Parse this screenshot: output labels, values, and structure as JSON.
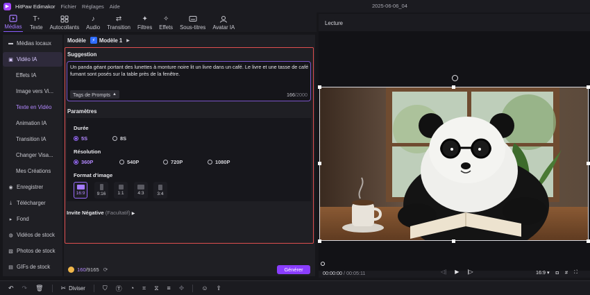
{
  "titlebar": {
    "app_name": "HitPaw Edimakor",
    "menu": [
      "Fichier",
      "Réglages",
      "Aide"
    ],
    "document_title": "2025-06-06_04"
  },
  "toolbar": {
    "items": [
      {
        "label": "Médias",
        "icon": "media-icon",
        "active": true
      },
      {
        "label": "Texte",
        "icon": "text-icon"
      },
      {
        "label": "Autocollants",
        "icon": "sticker-icon"
      },
      {
        "label": "Audio",
        "icon": "music-note-icon"
      },
      {
        "label": "Transition",
        "icon": "transition-arrows-icon"
      },
      {
        "label": "Filtres",
        "icon": "sparkle-filter-icon"
      },
      {
        "label": "Effets",
        "icon": "effects-icon"
      },
      {
        "label": "Sous-titres",
        "icon": "subtitle-icon"
      },
      {
        "label": "Avatar IA",
        "icon": "avatar-icon"
      }
    ]
  },
  "sidebar": {
    "items": [
      {
        "label": "Médias locaux",
        "icon": "folder-icon"
      },
      {
        "label": "Vidéo IA",
        "icon": "ai-video-icon",
        "state": "selected-parent"
      },
      {
        "label": "Effets IA",
        "sub": true
      },
      {
        "label": "Image vers Vi...",
        "sub": true
      },
      {
        "label": "Texte en Vidéo",
        "sub": true,
        "state": "selected-child"
      },
      {
        "label": "Animation IA",
        "sub": true
      },
      {
        "label": "Transition IA",
        "sub": true
      },
      {
        "label": "Changer Visa...",
        "sub": true
      },
      {
        "label": "Mes Créations",
        "sub": true
      },
      {
        "label": "Enregistrer",
        "icon": "record-icon"
      },
      {
        "label": "Télécharger",
        "icon": "download-icon"
      },
      {
        "label": "Fond",
        "icon": "chevron-right-icon"
      },
      {
        "label": "Vidéos de stock",
        "icon": "stock-video-icon"
      },
      {
        "label": "Photos de stock",
        "icon": "stock-photo-icon"
      },
      {
        "label": "GIFs de stock",
        "icon": "gif-icon"
      }
    ]
  },
  "model": {
    "label": "Modèle",
    "value": "Modèle 1"
  },
  "prompt": {
    "section_title": "Suggestion",
    "text": "Un panda géant portant des lunettes à monture noire lit un livre dans un café. Le livre et une tasse de café fumant sont posés sur la table près de la fenêtre.",
    "tags_label": "Tags de Prompts",
    "count": "166",
    "max": "/2000"
  },
  "params": {
    "section_title": "Paramètres",
    "duration": {
      "label": "Durée",
      "options": [
        "5S",
        "8S"
      ],
      "selected": "5S"
    },
    "resolution": {
      "label": "Résolution",
      "options": [
        "360P",
        "540P",
        "720P",
        "1080P"
      ],
      "selected": "360P"
    },
    "format": {
      "label": "Format d'image",
      "options": [
        "16:9",
        "9:16",
        "1:1",
        "4:3",
        "3:4"
      ],
      "selected": "16:9"
    }
  },
  "negative": {
    "label": "Invite Négative",
    "optional": "(Facultatif)"
  },
  "credits": {
    "used": "160",
    "total": "/9165",
    "generate_label": "Générer"
  },
  "preview": {
    "title": "Lecture",
    "current_time": "00:00:00",
    "duration": " / 00:05:11",
    "aspect": "16:9"
  },
  "bottombar": {
    "split_label": "Diviser"
  },
  "colors": {
    "accent": "#8a3dff",
    "highlight": "#e04f4f",
    "selected_text": "#b388ff"
  }
}
